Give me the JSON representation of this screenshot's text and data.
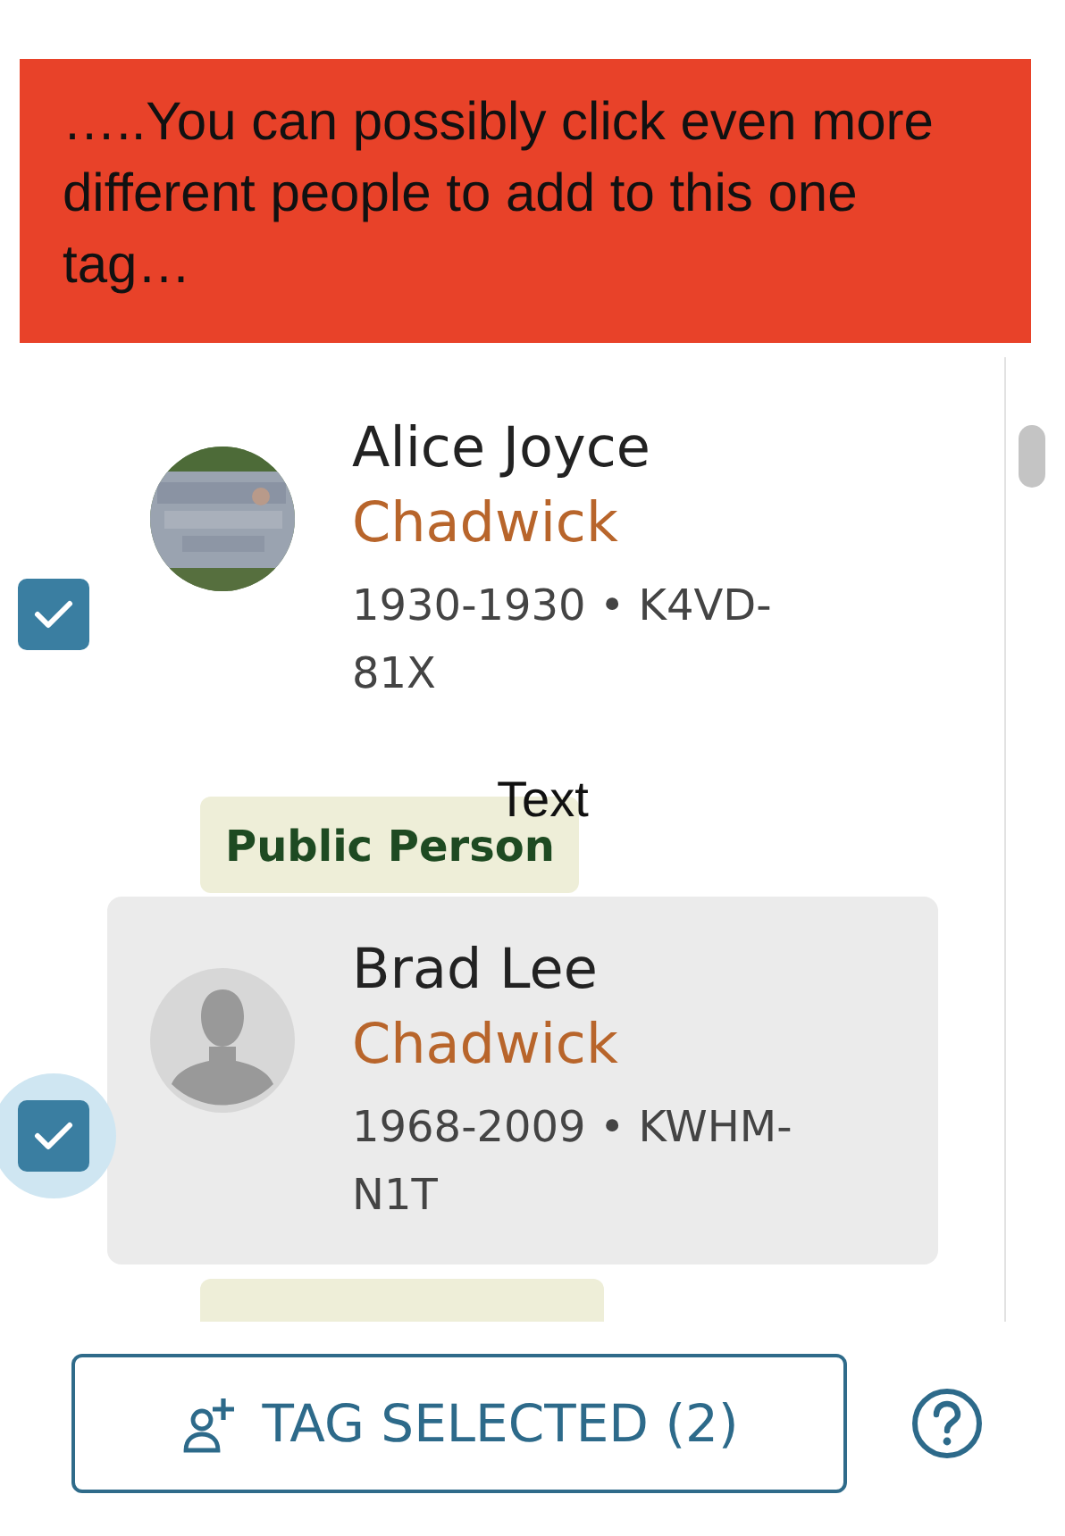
{
  "banner": {
    "text": "…..You can possibly click even more different people to add to this one tag…"
  },
  "people": [
    {
      "given": "Alice Joyce",
      "surname": "Chadwick",
      "details": "1930-1930 • K4VD-81X",
      "checked": true,
      "highlighted": false,
      "badge": "Public Person"
    },
    {
      "given": "Brad Lee",
      "surname": "Chadwick",
      "details": "1968-2009 • KWHM-N1T",
      "kind": "silhouette",
      "checked": true,
      "highlighted": true
    }
  ],
  "annotation": "Text",
  "tag_button": {
    "label": "TAG SELECTED (2)"
  }
}
